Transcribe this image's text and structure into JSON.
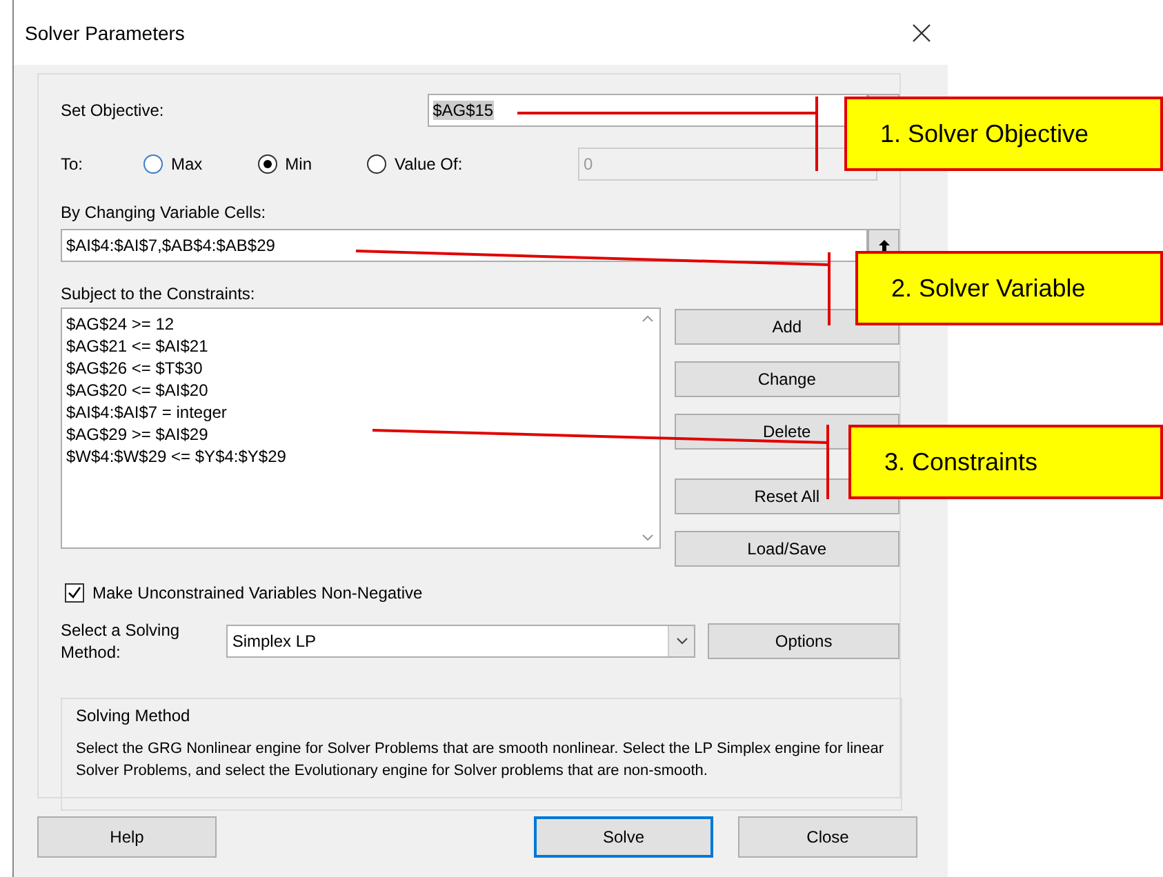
{
  "window": {
    "title": "Solver Parameters"
  },
  "objective": {
    "label": "Set Objective:",
    "value": "$AG$15"
  },
  "to": {
    "label": "To:",
    "options": [
      {
        "label": "Max",
        "selected": false
      },
      {
        "label": "Min",
        "selected": true
      },
      {
        "label": "Value Of:",
        "selected": false
      }
    ],
    "value_field": {
      "value": "0",
      "disabled": true
    }
  },
  "variables": {
    "label": "By Changing Variable Cells:",
    "value": "$AI$4:$AI$7,$AB$4:$AB$29"
  },
  "constraints": {
    "label": "Subject to the Constraints:",
    "items": [
      "$AG$24 >= 12",
      "$AG$21 <= $AI$21",
      "$AG$26 <= $T$30",
      "$AG$20 <= $AI$20",
      "$AI$4:$AI$7 = integer",
      "$AG$29 >= $AI$29",
      "$W$4:$W$29 <= $Y$4:$Y$29"
    ]
  },
  "side_buttons": [
    "Add",
    "Change",
    "Delete",
    "Reset All",
    "Load/Save"
  ],
  "nonnegative": {
    "label": "Make Unconstrained Variables Non-Negative",
    "checked": true
  },
  "method": {
    "label": "Select a Solving Method:",
    "value": "Simplex LP",
    "options_button": "Options"
  },
  "description": {
    "title": "Solving Method",
    "text": "Select the GRG Nonlinear engine for Solver Problems that are smooth nonlinear. Select the LP Simplex engine for linear Solver Problems, and select the Evolutionary engine for Solver problems that are non-smooth."
  },
  "footer_buttons": [
    {
      "label": "Help",
      "focused": false
    },
    {
      "label": "Solve",
      "focused": true
    },
    {
      "label": "Close",
      "focused": false
    }
  ],
  "annotations": [
    "1. Solver Objective",
    "2. Solver Variable",
    "3. Constraints"
  ]
}
